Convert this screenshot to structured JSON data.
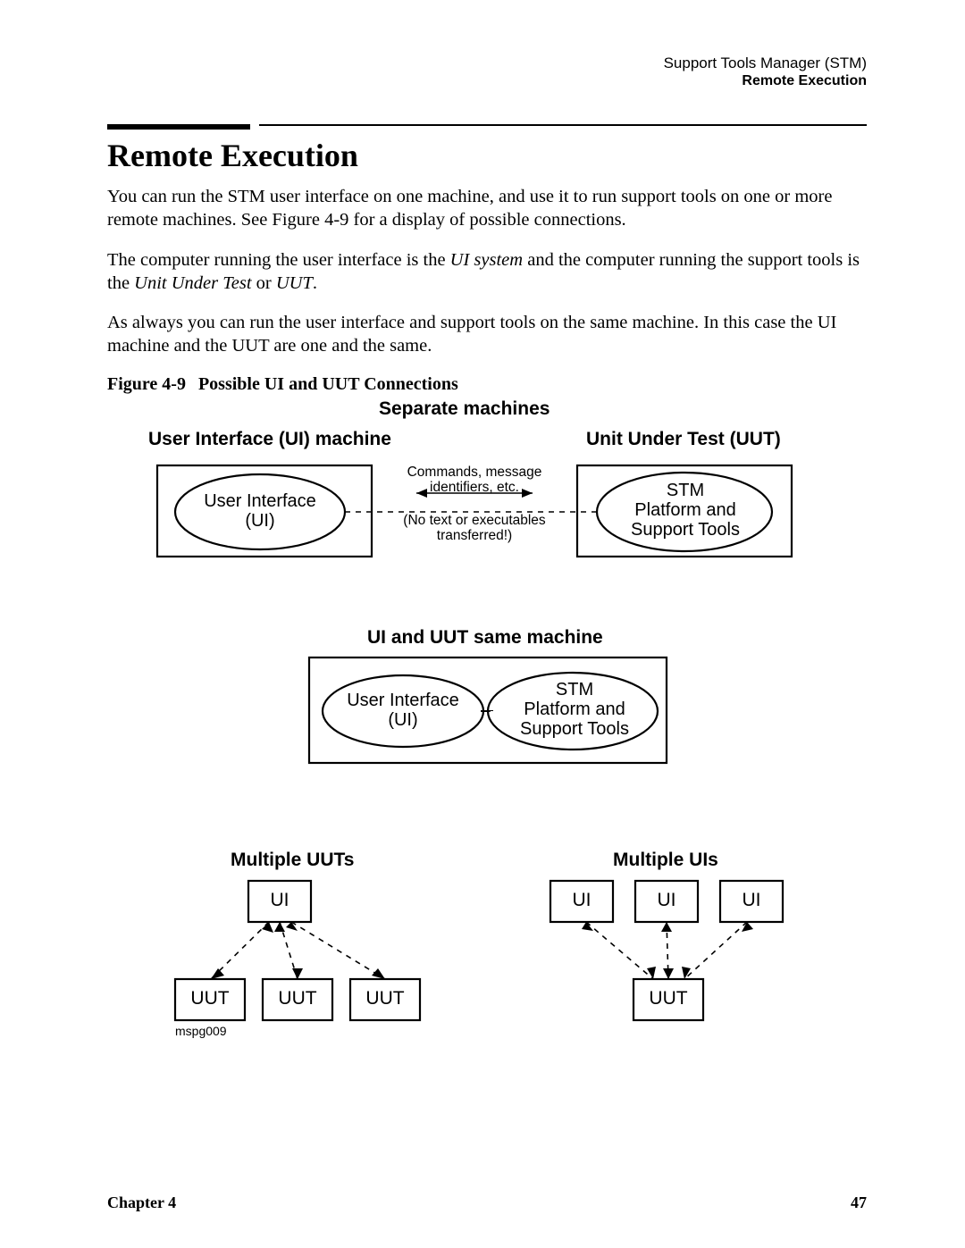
{
  "header": {
    "line1": "Support Tools Manager (STM)",
    "line2": "Remote Execution"
  },
  "title": "Remote Execution",
  "paragraphs": {
    "p1": "You can run the STM user interface on one machine, and use it to run support tools on one or more remote machines. See Figure 4-9 for a display of possible connections.",
    "p2a": "The computer running the user interface is the ",
    "p2_i1": "UI system",
    "p2b": " and the computer running the support tools is the ",
    "p2_i2": "Unit Under Test",
    "p2c": " or ",
    "p2_i3": "UUT",
    "p2d": ".",
    "p3": "As always you can run the user interface and support tools on the same machine. In this case the UI machine and the UUT are one and the same."
  },
  "figure": {
    "num": "Figure 4-9",
    "title": "Possible UI and UUT Connections"
  },
  "diagram": {
    "separate_title": "Separate machines",
    "ui_machine": "User Interface (UI) machine",
    "uut_machine": "Unit Under Test (UUT)",
    "ui_ellipse_l1": "User Interface",
    "ui_ellipse_l2": "(UI)",
    "stm_ellipse_l1": "STM",
    "stm_ellipse_l2": "Platform and",
    "stm_ellipse_l3": "Support Tools",
    "conn_top": "Commands, message",
    "conn_top2": "identifiers, etc.",
    "conn_bot1": "(No text or executables",
    "conn_bot2": "transferred!)",
    "same_title": "UI and UUT same machine",
    "multi_uuts": "Multiple UUTs",
    "multi_uis": "Multiple UIs",
    "ui_box": "UI",
    "uut_box": "UUT",
    "img_id": "mspg009"
  },
  "footer": {
    "left": "Chapter 4",
    "right": "47"
  }
}
